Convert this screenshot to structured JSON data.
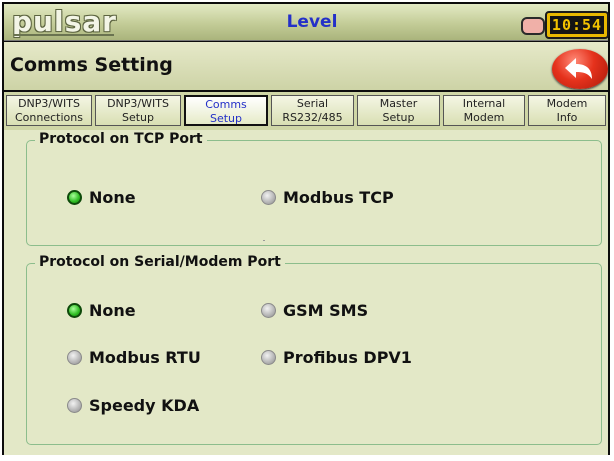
{
  "topbar": {
    "logo": "pulsar",
    "title": "Level",
    "clock": "10:54"
  },
  "header": {
    "title": "Comms Setting"
  },
  "tabs": [
    {
      "line1": "DNP3/WITS",
      "line2": "Connections",
      "active": false
    },
    {
      "line1": "DNP3/WITS",
      "line2": "Setup",
      "active": false
    },
    {
      "line1": "Comms",
      "line2": "Setup",
      "active": true
    },
    {
      "line1": "Serial",
      "line2": "RS232/485",
      "active": false
    },
    {
      "line1": "Master",
      "line2": "Setup",
      "active": false
    },
    {
      "line1": "Internal",
      "line2": "Modem",
      "active": false
    },
    {
      "line1": "Modem",
      "line2": "Info",
      "active": false
    }
  ],
  "tcp_group": {
    "title": "Protocol on TCP Port",
    "options": [
      {
        "label": "None",
        "selected": true
      },
      {
        "label": "Modbus TCP",
        "selected": false
      }
    ]
  },
  "serial_group": {
    "title": "Protocol on Serial/Modem Port",
    "options": [
      {
        "label": "None",
        "selected": true
      },
      {
        "label": "GSM SMS",
        "selected": false
      },
      {
        "label": "Modbus RTU",
        "selected": false
      },
      {
        "label": "Profibus DPV1",
        "selected": false
      },
      {
        "label": "Speedy KDA",
        "selected": false
      }
    ]
  },
  "colors": {
    "title_blue": "#2430c8",
    "selected_green": "#2ebc22",
    "back_red": "#e5321c",
    "clock_amber": "#e8b800"
  }
}
